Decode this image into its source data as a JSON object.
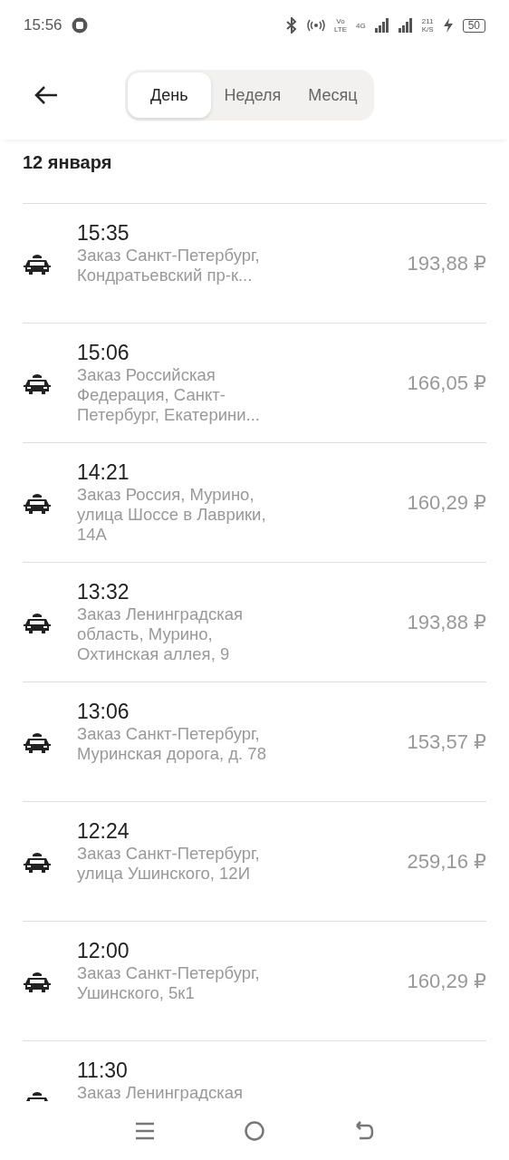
{
  "status_bar": {
    "time": "15:56",
    "volte_top": "Vo",
    "volte_bottom": "LTE",
    "network": "4G",
    "speed_value": "211",
    "speed_unit": "K/S",
    "battery": "50"
  },
  "tabs": [
    {
      "label": "День",
      "selected": true
    },
    {
      "label": "Неделя",
      "selected": false
    },
    {
      "label": "Месяц",
      "selected": false
    }
  ],
  "date_heading": "12 января",
  "orders": [
    {
      "time": "15:35",
      "address": "Заказ Санкт-Петербург, Кондратьевский пр-к...",
      "price": "193,88 ₽"
    },
    {
      "time": "15:06",
      "address": "Заказ Российская Федерация, Санкт-Петербург, Екатерини...",
      "price": "166,05 ₽"
    },
    {
      "time": "14:21",
      "address": "Заказ Россия, Мурино, улица Шоссе в Лаврики, 14А",
      "price": "160,29 ₽"
    },
    {
      "time": "13:32",
      "address": "Заказ Ленинградская область, Мурино, Охтинская аллея, 9",
      "price": "193,88 ₽"
    },
    {
      "time": "13:06",
      "address": "Заказ Санкт-Петербург, Муринская дорога, д. 78",
      "price": "153,57 ₽"
    },
    {
      "time": "12:24",
      "address": "Заказ Санкт-Петербург, улица Ушинского, 12И",
      "price": "259,16 ₽"
    },
    {
      "time": "12:00",
      "address": "Заказ Санкт-Петербург, Ушинского, 5к1",
      "price": "160,29 ₽"
    },
    {
      "time": "11:30",
      "address": "Заказ Ленинградская"
    }
  ]
}
